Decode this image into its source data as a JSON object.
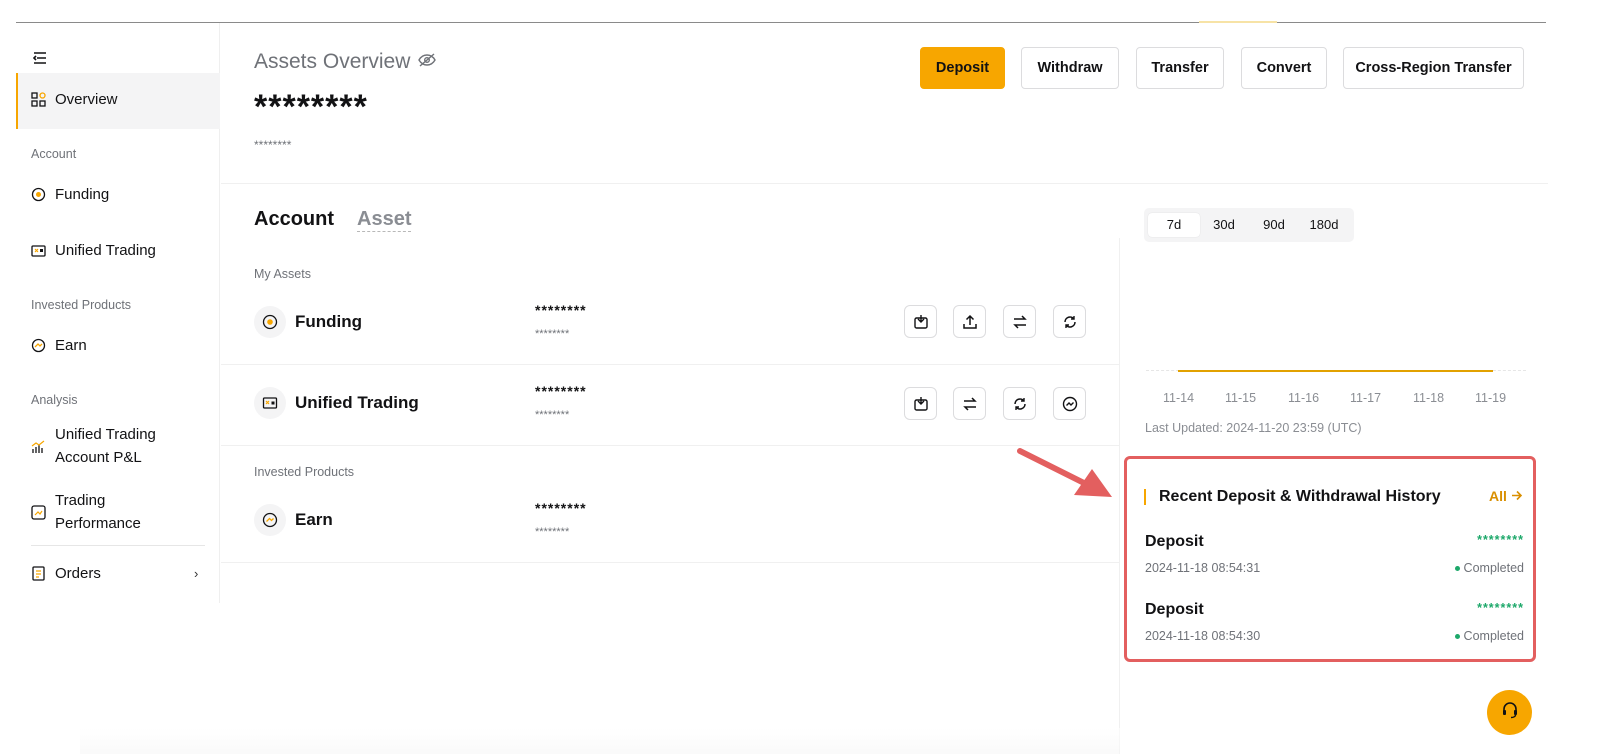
{
  "sidebar": {
    "items": [
      {
        "label": "Overview",
        "icon": "overview-icon"
      },
      {
        "label": "Funding",
        "icon": "coin-icon"
      },
      {
        "label": "Unified Trading",
        "icon": "wallet-icon"
      },
      {
        "label": "Earn",
        "icon": "earn-icon"
      },
      {
        "label_line1": "Unified Trading",
        "label_line2": "Account P&L",
        "icon": "bar-chart-icon"
      },
      {
        "label_line1": "Trading",
        "label_line2": "Performance",
        "icon": "performance-icon"
      },
      {
        "label": "Orders",
        "icon": "orders-icon"
      }
    ],
    "groups": {
      "account": "Account",
      "invested": "Invested Products",
      "analysis": "Analysis"
    }
  },
  "header": {
    "title": "Assets Overview",
    "balance": "********",
    "sub_balance": "********",
    "buttons": {
      "deposit": "Deposit",
      "withdraw": "Withdraw",
      "transfer": "Transfer",
      "convert": "Convert",
      "cross_region": "Cross-Region Transfer"
    }
  },
  "tabs": {
    "account": "Account",
    "asset": "Asset"
  },
  "my_assets": {
    "label": "My Assets",
    "rows": [
      {
        "name": "Funding",
        "value": "********",
        "sub": "********"
      },
      {
        "name": "Unified Trading",
        "value": "********",
        "sub": "********"
      }
    ]
  },
  "invested": {
    "label": "Invested Products",
    "rows": [
      {
        "name": "Earn",
        "value": "********",
        "sub": "********"
      }
    ]
  },
  "chart": {
    "periods": [
      "7d",
      "30d",
      "90d",
      "180d"
    ],
    "selected": "7d",
    "x_labels": [
      "11-14",
      "11-15",
      "11-16",
      "11-17",
      "11-18",
      "11-19"
    ],
    "last_updated": "Last Updated: 2024-11-20 23:59 (UTC)"
  },
  "history": {
    "title": "Recent Deposit & Withdrawal History",
    "all_label": "All",
    "items": [
      {
        "type": "Deposit",
        "amount": "********",
        "date": "2024-11-18 08:54:31",
        "status": "Completed"
      },
      {
        "type": "Deposit",
        "amount": "********",
        "date": "2024-11-18 08:54:30",
        "status": "Completed"
      }
    ]
  },
  "colors": {
    "accent": "#f7a600",
    "positive": "#1da86a",
    "highlight": "#e35f5f"
  }
}
